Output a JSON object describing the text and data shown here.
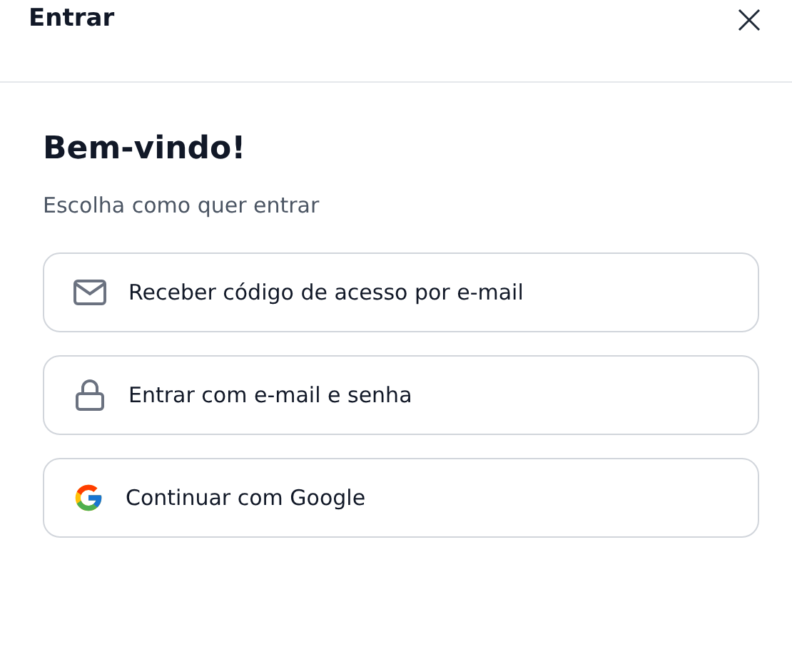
{
  "dialog": {
    "title": "Entrar"
  },
  "heading": "Bem-vindo!",
  "subtitle": "Escolha como quer entrar",
  "options": [
    {
      "kind": "email",
      "label": "Receber código de acesso por e-mail"
    },
    {
      "kind": "password",
      "label": "Entrar com e-mail e senha"
    },
    {
      "kind": "google",
      "label": "Continuar com Google"
    }
  ]
}
